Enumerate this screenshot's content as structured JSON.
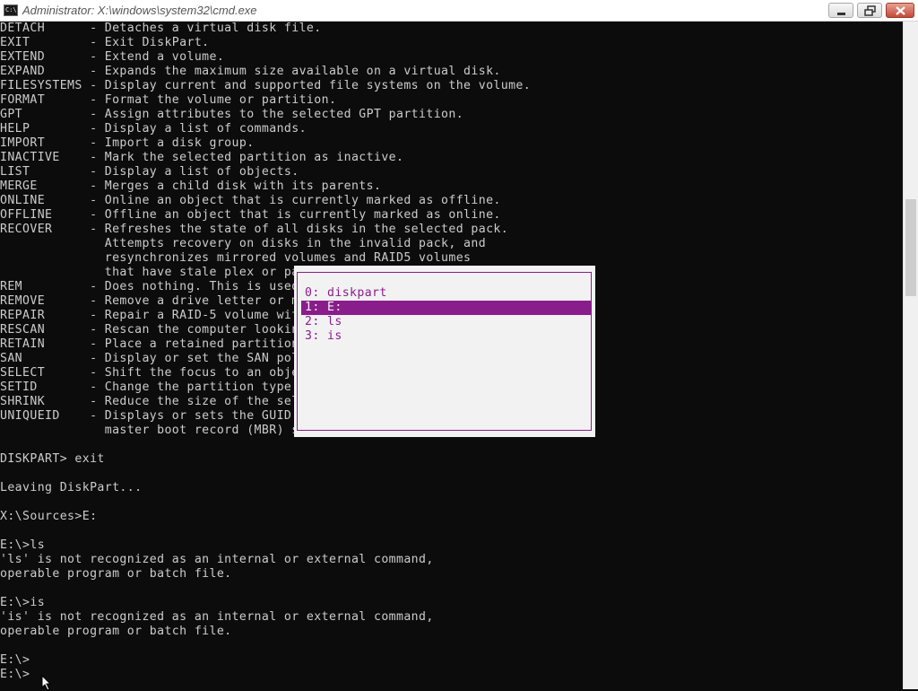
{
  "window": {
    "title": "Administrator: X:\\windows\\system32\\cmd.exe",
    "icon_text": "C:\\"
  },
  "console": {
    "lines": [
      "DETACH      - Detaches a virtual disk file.",
      "EXIT        - Exit DiskPart.",
      "EXTEND      - Extend a volume.",
      "EXPAND      - Expands the maximum size available on a virtual disk.",
      "FILESYSTEMS - Display current and supported file systems on the volume.",
      "FORMAT      - Format the volume or partition.",
      "GPT         - Assign attributes to the selected GPT partition.",
      "HELP        - Display a list of commands.",
      "IMPORT      - Import a disk group.",
      "INACTIVE    - Mark the selected partition as inactive.",
      "LIST        - Display a list of objects.",
      "MERGE       - Merges a child disk with its parents.",
      "ONLINE      - Online an object that is currently marked as offline.",
      "OFFLINE     - Offline an object that is currently marked as online.",
      "RECOVER     - Refreshes the state of all disks in the selected pack.",
      "              Attempts recovery on disks in the invalid pack, and",
      "              resynchronizes mirrored volumes and RAID5 volumes",
      "              that have stale plex or par",
      "REM         - Does nothing. This is used",
      "REMOVE      - Remove a drive letter or mo",
      "REPAIR      - Repair a RAID-5 volume with",
      "RESCAN      - Rescan the computer looking",
      "RETAIN      - Place a retained partition",
      "SAN         - Display or set the SAN poli",
      "SELECT      - Shift the focus to an objec",
      "SETID       - Change the partition type.",
      "SHRINK      - Reduce the size of the sele",
      "UNIQUEID    - Displays or sets the GUID p",
      "              master boot record (MBR) si",
      "",
      "DISKPART> exit",
      "",
      "Leaving DiskPart...",
      "",
      "X:\\Sources>E:",
      "",
      "E:\\>ls",
      "'ls' is not recognized as an internal or external command,",
      "operable program or batch file.",
      "",
      "E:\\>is",
      "'is' is not recognized as an internal or external command,",
      "operable program or batch file.",
      "",
      "E:\\>",
      "E:\\>"
    ]
  },
  "history_popup": {
    "items": [
      "0: diskpart",
      "1: E:",
      "2: ls",
      "3: is"
    ],
    "selected_index": 1
  },
  "colors": {
    "console_bg": "#0c0c0c",
    "console_text": "#cccccc",
    "popup_bg": "#f2f2f2",
    "popup_accent": "#8a1d8c"
  },
  "icons": {
    "app": "cmd-icon",
    "minimize": "minimize-icon",
    "maximize": "restore-icon",
    "close": "close-icon",
    "pointer": "mouse-pointer-icon"
  }
}
